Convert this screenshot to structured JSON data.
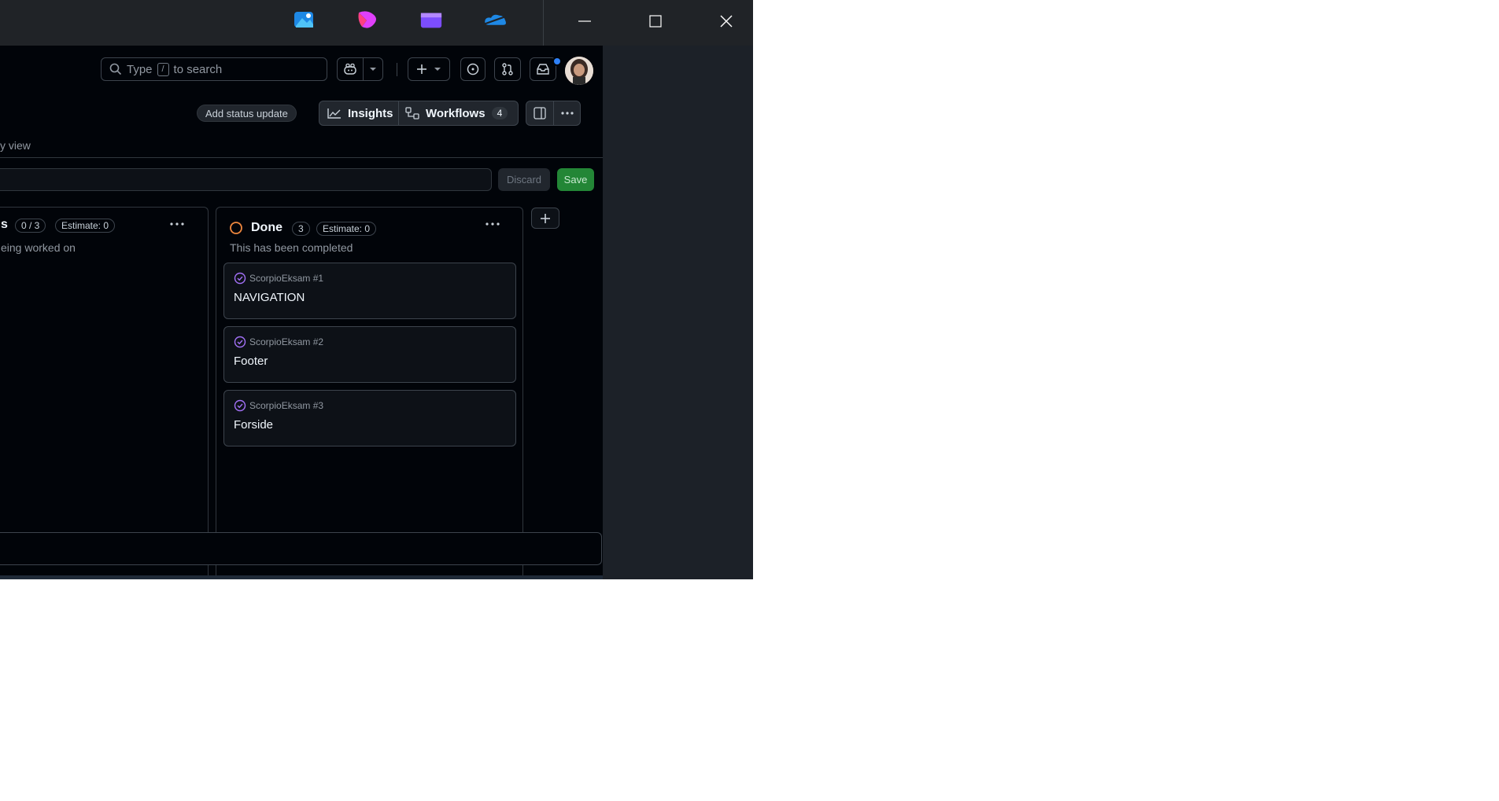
{
  "taskbar": {
    "icons": [
      "photos-icon",
      "copilot-app-icon",
      "clipchamp-icon",
      "onedrive-icon"
    ]
  },
  "window_controls": {
    "minimize": "minimize-icon",
    "maximize": "maximize-icon",
    "close": "close-icon"
  },
  "header": {
    "search_prefix": "Type",
    "search_key": "/",
    "search_suffix": "to search"
  },
  "toolbar": {
    "status_update": "Add status update",
    "insights": "Insights",
    "workflows": "Workflows",
    "workflows_count": "4",
    "view_label": "y view"
  },
  "filter_actions": {
    "discard": "Discard",
    "save": "Save"
  },
  "columns": [
    {
      "name": "s",
      "count": "0 / 3",
      "estimate": "Estimate: 0",
      "description": "eing worked on",
      "cards": []
    },
    {
      "name": "Done",
      "count": "3",
      "estimate": "Estimate: 0",
      "description": "This has been completed",
      "status_color": "#f0883e",
      "cards": [
        {
          "repo": "ScorpioEksam #1",
          "title": "NAVIGATION"
        },
        {
          "repo": "ScorpioEksam #2",
          "title": "Footer"
        },
        {
          "repo": "ScorpioEksam #3",
          "title": "Forside"
        }
      ]
    }
  ],
  "colors": {
    "accent_done": "#f0883e",
    "issue_closed": "#a371f7",
    "save_green": "#238636"
  }
}
